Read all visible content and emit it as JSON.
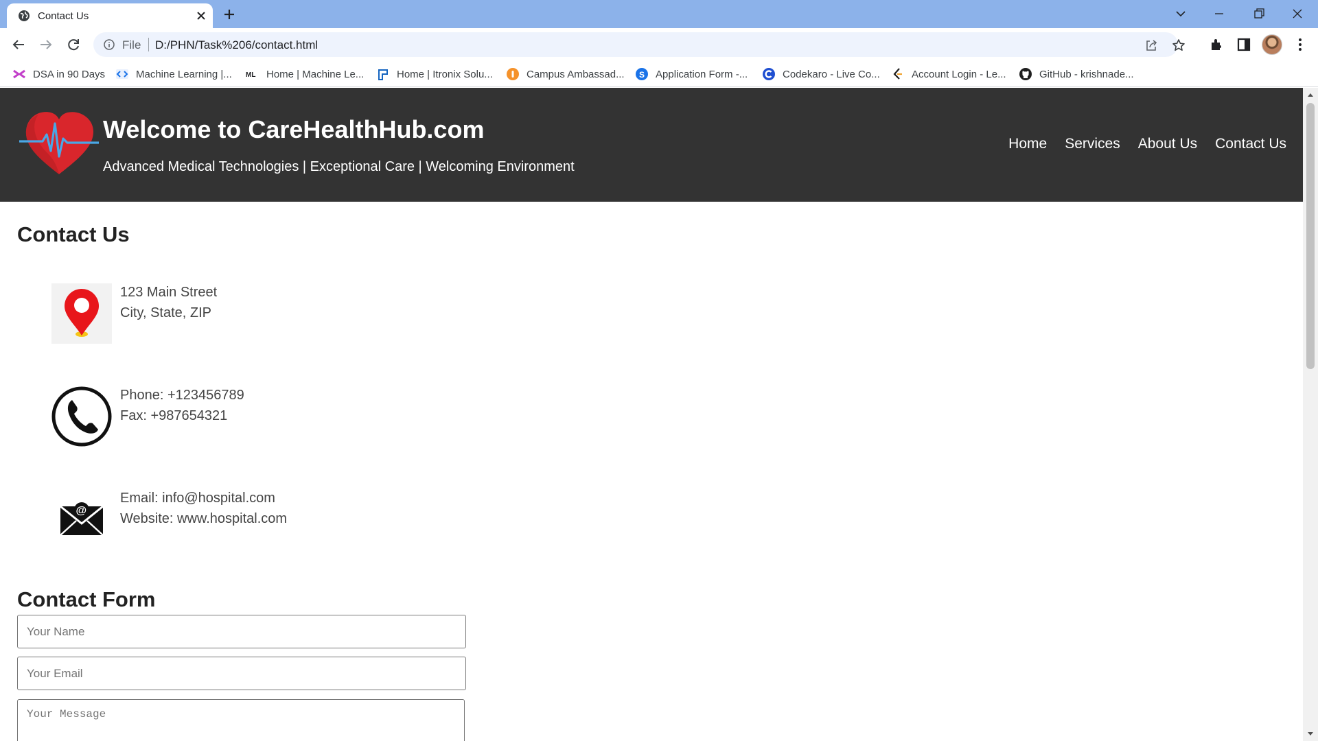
{
  "browser": {
    "tab_title": "Contact Us",
    "omnibox_scheme": "File",
    "omnibox_url": "D:/PHN/Task%206/contact.html",
    "bookmarks": [
      {
        "label": "DSA in 90 Days",
        "icon": "dsa-icon"
      },
      {
        "label": "Machine Learning |...",
        "icon": "code-brackets-icon"
      },
      {
        "label": "Home | Machine Le...",
        "icon": "ml-icon"
      },
      {
        "label": "Home | Itronix Solu...",
        "icon": "itronix-icon"
      },
      {
        "label": "Campus Ambassad...",
        "icon": "campus-icon"
      },
      {
        "label": "Application Form -...",
        "icon": "s-icon"
      },
      {
        "label": "Codekaro - Live Co...",
        "icon": "c-icon"
      },
      {
        "label": "Account Login - Le...",
        "icon": "leetcode-icon"
      },
      {
        "label": "GitHub - krishnade...",
        "icon": "github-icon"
      }
    ]
  },
  "site": {
    "title": "Welcome to CareHealthHub.com",
    "tagline": "Advanced Medical Technologies | Exceptional Care | Welcoming Environment",
    "nav": [
      "Home",
      "Services",
      "About Us",
      "Contact Us"
    ],
    "logo_icon": "heart-pulse-icon",
    "colors": {
      "header_bg": "#333333",
      "logo_red": "#d9262c",
      "pulse_blue": "#4aa7e6"
    }
  },
  "contact": {
    "heading": "Contact Us",
    "address": {
      "line1": "123 Main Street",
      "line2": "City, State, ZIP",
      "icon": "location-pin-icon"
    },
    "phone": {
      "line1": "Phone: +123456789",
      "line2": "Fax: +987654321",
      "icon": "phone-icon"
    },
    "email": {
      "line1": "Email: info@hospital.com",
      "line2": "Website: www.hospital.com",
      "icon": "mail-icon"
    }
  },
  "form": {
    "heading": "Contact Form",
    "name_placeholder": "Your Name",
    "email_placeholder": "Your Email",
    "message_placeholder": "Your Message"
  }
}
